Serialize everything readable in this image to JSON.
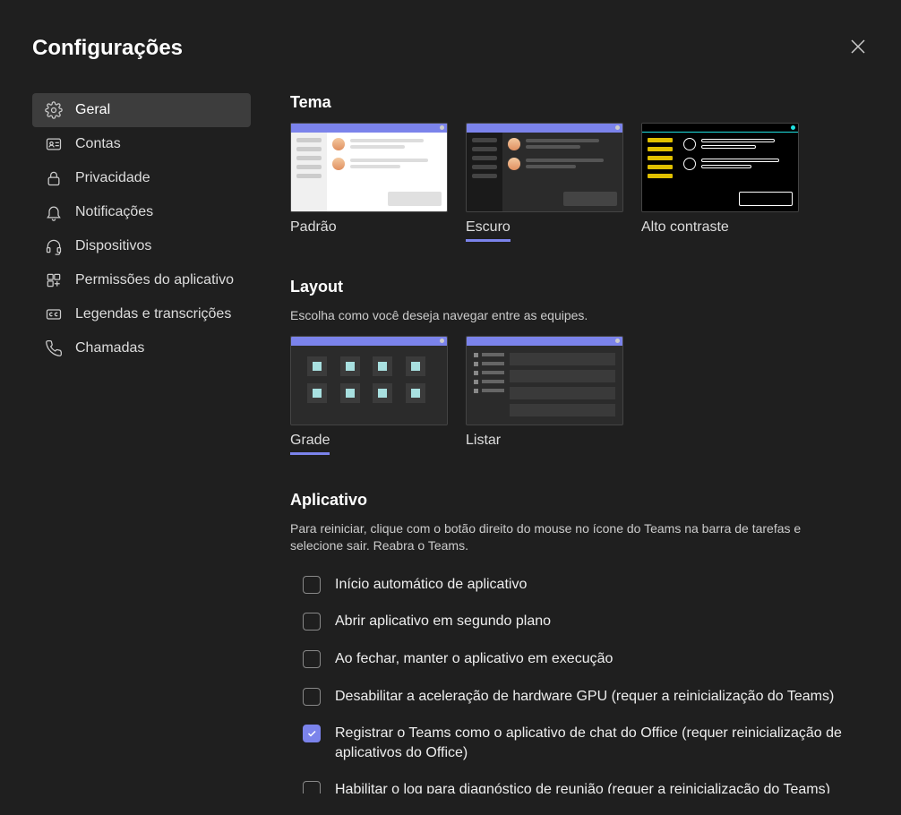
{
  "title": "Configurações",
  "sidebar": {
    "items": [
      {
        "label": "Geral",
        "selected": true,
        "icon": "gear"
      },
      {
        "label": "Contas",
        "selected": false,
        "icon": "id-card"
      },
      {
        "label": "Privacidade",
        "selected": false,
        "icon": "lock"
      },
      {
        "label": "Notificações",
        "selected": false,
        "icon": "bell"
      },
      {
        "label": "Dispositivos",
        "selected": false,
        "icon": "headset"
      },
      {
        "label": "Permissões do aplicativo",
        "selected": false,
        "icon": "apps"
      },
      {
        "label": "Legendas e transcrições",
        "selected": false,
        "icon": "cc"
      },
      {
        "label": "Chamadas",
        "selected": false,
        "icon": "phone"
      }
    ]
  },
  "theme": {
    "heading": "Tema",
    "options": [
      {
        "label": "Padrão",
        "selected": false,
        "kind": "light"
      },
      {
        "label": "Escuro",
        "selected": true,
        "kind": "dark"
      },
      {
        "label": "Alto contraste",
        "selected": false,
        "kind": "hc"
      }
    ]
  },
  "layout": {
    "heading": "Layout",
    "desc": "Escolha como você deseja navegar entre as equipes.",
    "options": [
      {
        "label": "Grade",
        "selected": true,
        "kind": "grid"
      },
      {
        "label": "Listar",
        "selected": false,
        "kind": "list"
      }
    ]
  },
  "app": {
    "heading": "Aplicativo",
    "desc": "Para reiniciar, clique com o botão direito do mouse no ícone do Teams na barra de tarefas e selecione sair. Reabra o Teams.",
    "checkboxes": [
      {
        "label": "Início automático de aplicativo",
        "checked": false
      },
      {
        "label": "Abrir aplicativo em segundo plano",
        "checked": false
      },
      {
        "label": "Ao fechar, manter o aplicativo em execução",
        "checked": false
      },
      {
        "label": "Desabilitar a aceleração de hardware GPU (requer a reinicialização do Teams)",
        "checked": false
      },
      {
        "label": "Registrar o Teams como o aplicativo de chat do Office (requer reinicialização de aplicativos do Office)",
        "checked": true
      },
      {
        "label": "Habilitar o log para diagnóstico de reunião (requer a reinicialização do Teams)",
        "checked": false
      }
    ]
  }
}
